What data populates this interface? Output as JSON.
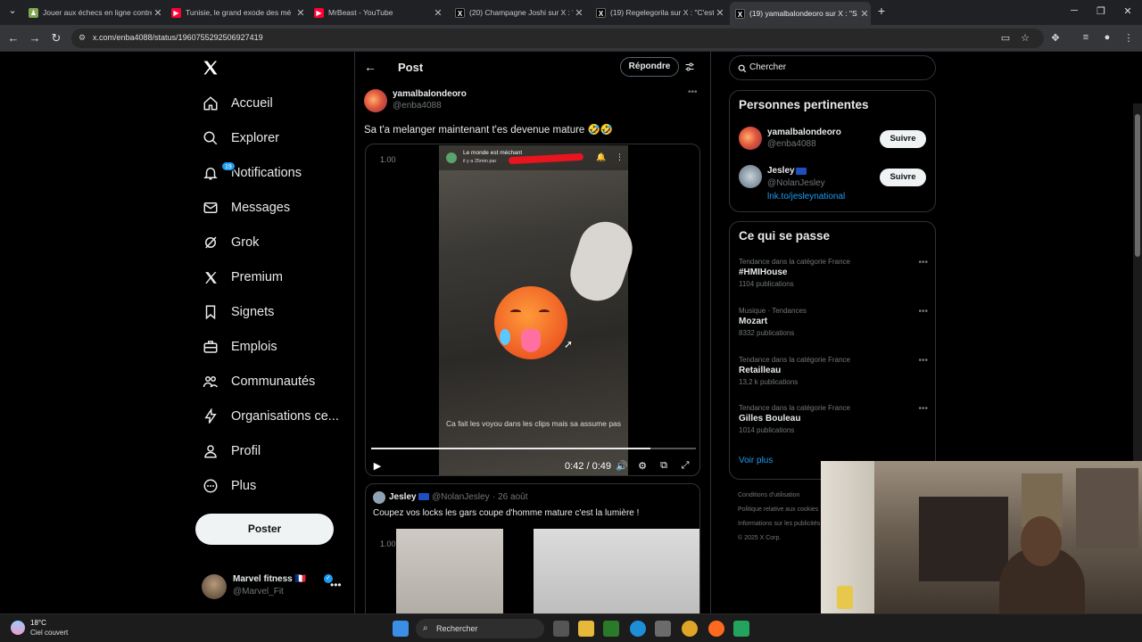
{
  "browser": {
    "tabs": [
      {
        "title": "Jouer aux échecs en ligne contre",
        "favicon": "chess-icon",
        "color": "#7fa650"
      },
      {
        "title": "Tunisie, le grand exode des mé",
        "favicon": "youtube-icon",
        "color": "#ff0033"
      },
      {
        "title": "MrBeast - YouTube",
        "favicon": "youtube-icon",
        "color": "#ff0033"
      },
      {
        "title": "(20) Champagne Joshi sur X : \"I",
        "favicon": "x-icon",
        "color": "#000000"
      },
      {
        "title": "(19) Regelegorila sur X : \"C'est u",
        "favicon": "x-icon",
        "color": "#000000"
      },
      {
        "title": "(19) yamalbalondeoro sur X : \"S",
        "favicon": "x-icon",
        "color": "#000000",
        "active": true
      }
    ],
    "new_tab": "+",
    "url": "x.com/enba4088/status/1960755292506927419"
  },
  "sidebar": {
    "items": [
      {
        "label": "Accueil",
        "icon": "home-icon"
      },
      {
        "label": "Explorer",
        "icon": "search-icon"
      },
      {
        "label": "Notifications",
        "icon": "bell-icon",
        "badge": "19"
      },
      {
        "label": "Messages",
        "icon": "envelope-icon"
      },
      {
        "label": "Grok",
        "icon": "grok-icon"
      },
      {
        "label": "Premium",
        "icon": "x-premium-icon"
      },
      {
        "label": "Signets",
        "icon": "bookmark-icon"
      },
      {
        "label": "Emplois",
        "icon": "briefcase-icon"
      },
      {
        "label": "Communautés",
        "icon": "communities-icon"
      },
      {
        "label": "Organisations ce...",
        "icon": "lightning-icon"
      },
      {
        "label": "Profil",
        "icon": "profile-icon"
      },
      {
        "label": "Plus",
        "icon": "more-circle-icon"
      }
    ],
    "post_button": "Poster",
    "account": {
      "name": "Marvel fitness 🇫🇷",
      "handle": "@Marvel_Fit"
    }
  },
  "post": {
    "header_title": "Post",
    "reply_button": "Répondre",
    "author": {
      "name": "yamalbalondeoro",
      "handle": "@enba4088"
    },
    "text": "Sa t'a melanger maintenant t'es devenue mature 🤣🤣",
    "video": {
      "speed": "1.00",
      "overlay_title": "Le monde est méchant",
      "overlay_sub": "il y a 25min par",
      "caption": "Ca fait les voyou dans les clips mais sa assume pas",
      "time": "0:42 / 0:49",
      "progress": 0.86
    },
    "reply": {
      "name": "Jesley",
      "handle": "@NolanJesley",
      "date": "· 26 août",
      "text": "Coupez vos locks les gars coupe d'homme mature c'est la lumière !",
      "speed": "1.00"
    }
  },
  "right": {
    "search_placeholder": "Chercher",
    "relevant": {
      "title": "Personnes pertinentes",
      "people": [
        {
          "name": "yamalbalondeoro",
          "handle": "@enba4088",
          "button": "Suivre"
        },
        {
          "name": "Jesley",
          "handle": "@NolanJesley",
          "link": "lnk.to/jesleynational",
          "button": "Suivre"
        }
      ]
    },
    "trends": {
      "title": "Ce qui se passe",
      "items": [
        {
          "category": "Tendance dans la catégorie France",
          "name": "#HMIHouse",
          "count": "1104 publications"
        },
        {
          "category": "Musique · Tendances",
          "name": "Mozart",
          "count": "8332 publications"
        },
        {
          "category": "Tendance dans la catégorie France",
          "name": "Retailleau",
          "count": "13,2 k publications"
        },
        {
          "category": "Tendance dans la catégorie France",
          "name": "Gilles Bouleau",
          "count": "1014 publications"
        }
      ],
      "show_more": "Voir plus"
    },
    "footer": [
      "Conditions d'utilisation",
      "Politique relative aux cookies",
      "Informations sur les publicités",
      "© 2025 X Corp."
    ]
  },
  "taskbar": {
    "temp": "18°C",
    "weather": "Ciel couvert",
    "search": "Rechercher"
  },
  "colors": {
    "accent": "#1d9bf0",
    "bg": "#000000",
    "border": "#2f3336",
    "muted": "#71767b"
  }
}
